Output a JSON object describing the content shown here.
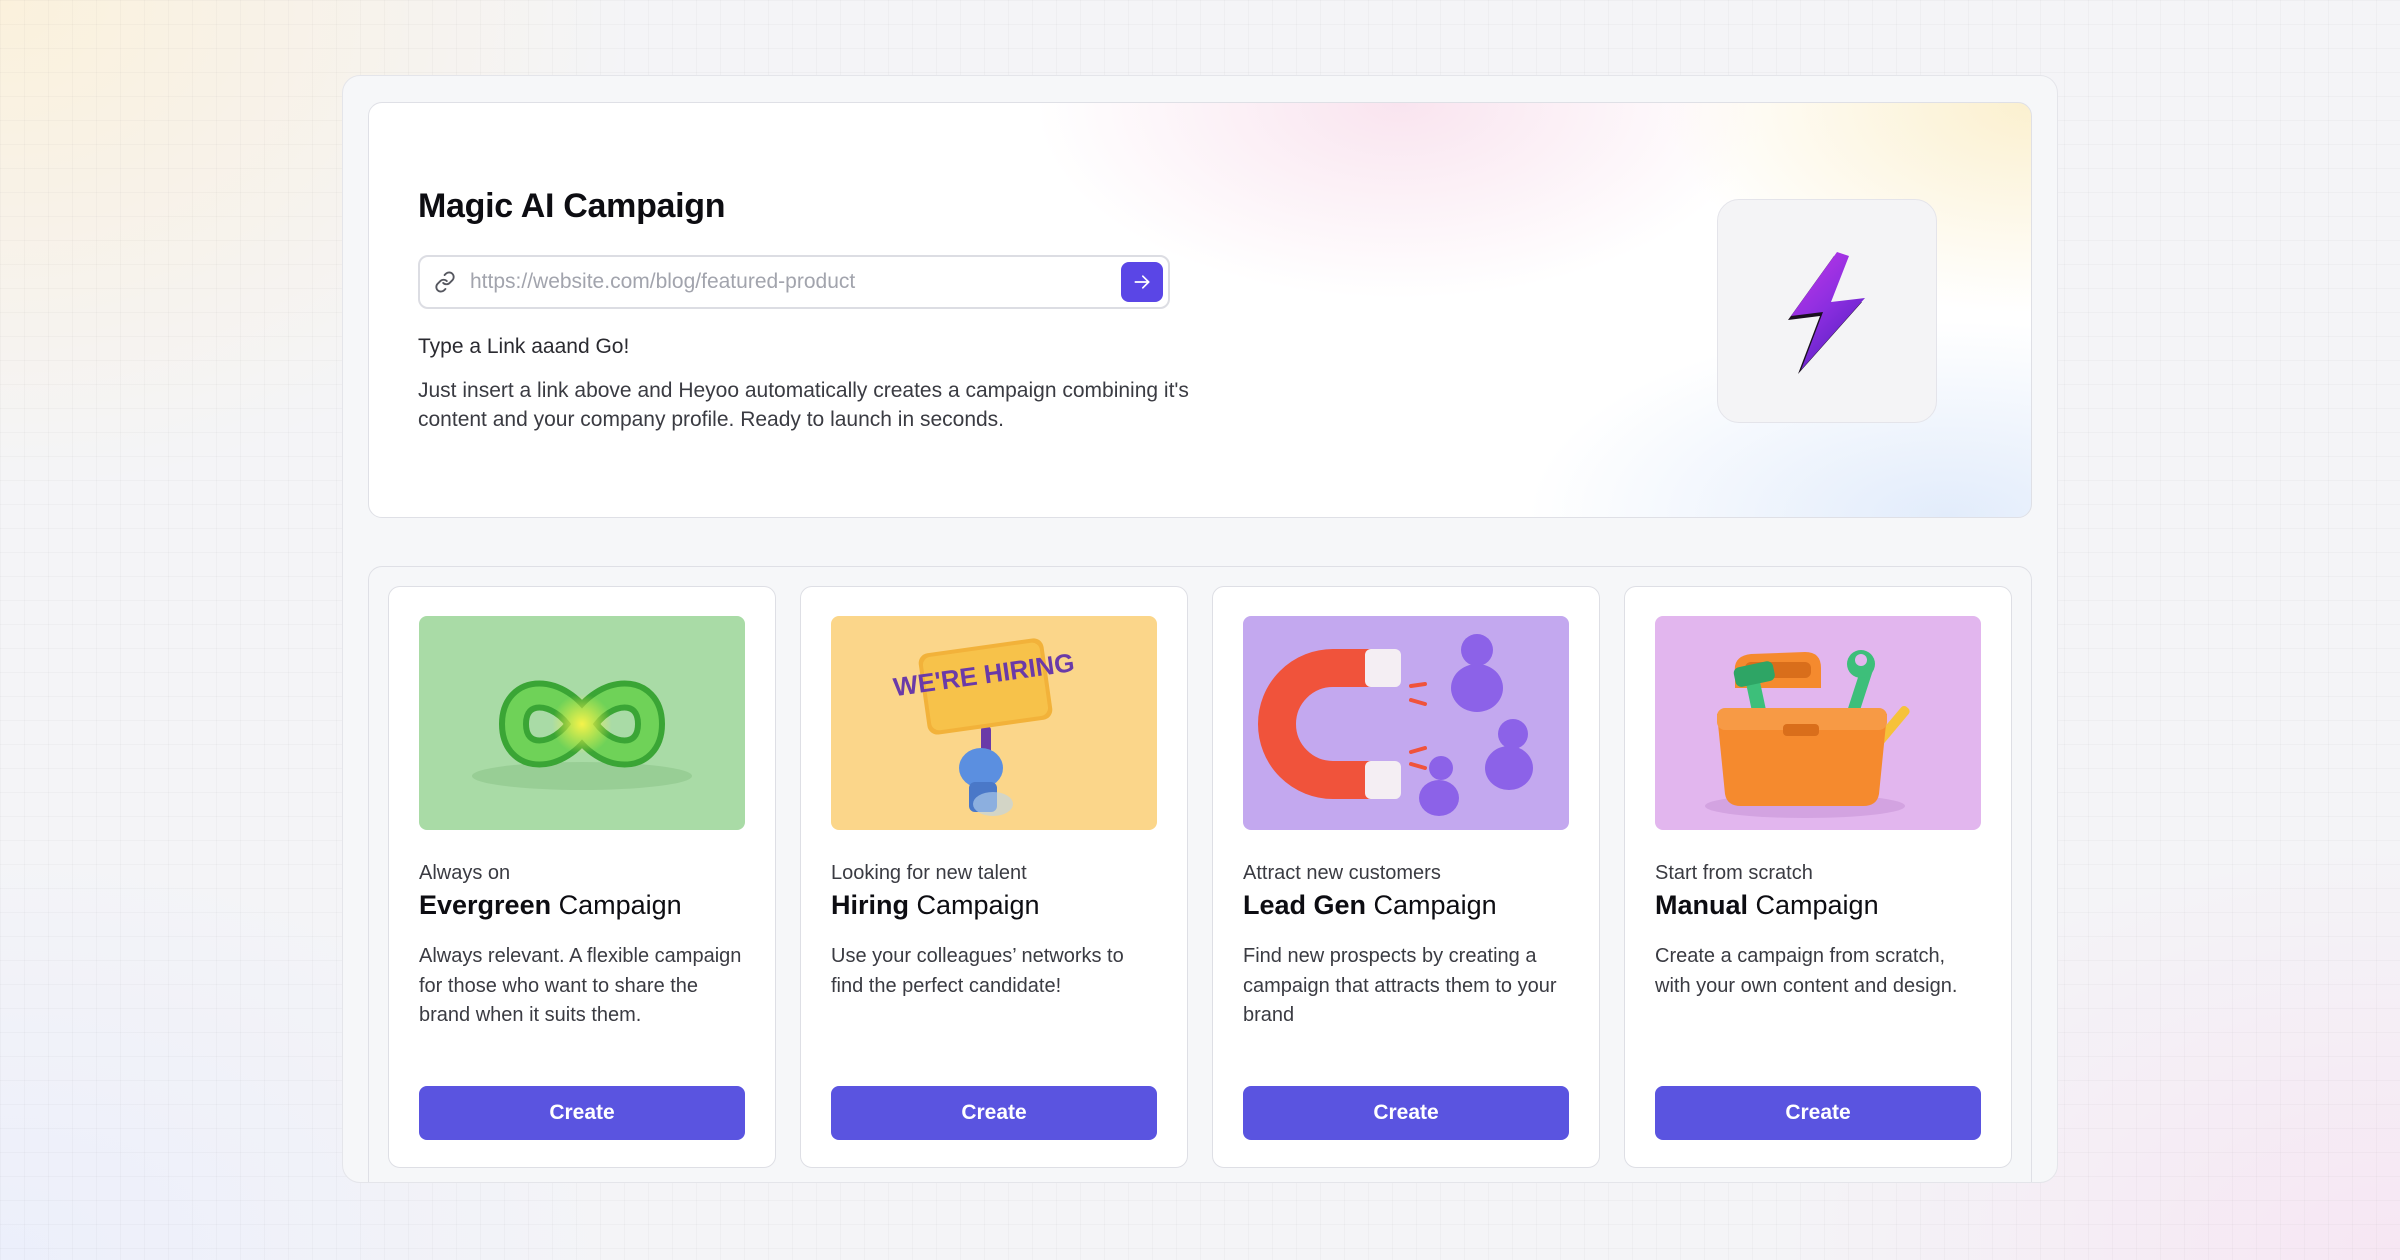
{
  "hero": {
    "title": "Magic AI Campaign",
    "link_placeholder": "https://website.com/blog/featured-product",
    "link_icon": "link-icon",
    "go_icon": "arrow-right-icon",
    "tagline": "Type a Link aaand Go!",
    "description": "Just insert a link above and Heyoo automatically creates a campaign combining it's content and your company profile. Ready to launch in seconds.",
    "badge_icon": "lightning-bolt-icon"
  },
  "cards": [
    {
      "kicker": "Always on",
      "title_bold": "Evergreen",
      "title_rest": " Campaign",
      "description": "Always relevant. A flexible campaign for those who want to share the brand when it suits them.",
      "button": "Create",
      "image": "infinity-illustration",
      "image_bg": "#a9dba6"
    },
    {
      "kicker": "Looking for new talent",
      "title_bold": "Hiring",
      "title_rest": " Campaign",
      "description": "Use your colleagues’ networks to find the perfect candidate!",
      "button": "Create",
      "image": "hiring-sign-illustration",
      "image_bg": "#fbd68a",
      "image_text": "WE'RE HIRING"
    },
    {
      "kicker": "Attract new customers",
      "title_bold": "Lead Gen",
      "title_rest": " Campaign",
      "description": "Find new prospects by creating a campaign that attracts them to your brand",
      "button": "Create",
      "image": "magnet-people-illustration",
      "image_bg": "#c3a8ef"
    },
    {
      "kicker": "Start from scratch",
      "title_bold": "Manual",
      "title_rest": " Campaign",
      "description": "Create a campaign from scratch, with your own content and design.",
      "button": "Create",
      "image": "toolbox-illustration",
      "image_bg": "#e2b6ee"
    }
  ],
  "colors": {
    "accent": "#5a54e0",
    "go_button": "#5a46e6"
  }
}
